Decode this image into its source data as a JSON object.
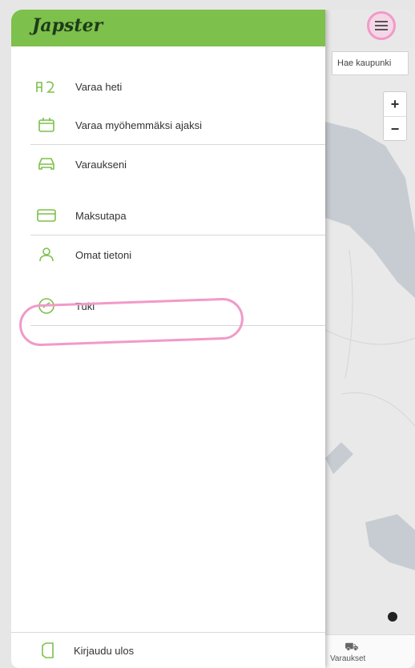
{
  "app": {
    "logo": "Japster"
  },
  "map": {
    "search_placeholder": "Hae kaupunki",
    "zoom_in": "+",
    "zoom_out": "−",
    "bottom_tab_label": "Varaukset"
  },
  "menu": {
    "items": [
      {
        "label": "Varaa heti",
        "icon": "parking-icon"
      },
      {
        "label": "Varaa myöhemmäksi ajaksi",
        "icon": "calendar-icon"
      },
      {
        "label": "Varaukseni",
        "icon": "car-icon"
      },
      {
        "label": "Maksutapa",
        "icon": "credit-card-icon"
      },
      {
        "label": "Omat tietoni",
        "icon": "user-icon"
      },
      {
        "label": "Tuki",
        "icon": "support-icon"
      }
    ],
    "logout_label": "Kirjaudu ulos"
  },
  "colors": {
    "brand_green": "#7dc04b",
    "highlight_pink": "#f19ac8"
  }
}
